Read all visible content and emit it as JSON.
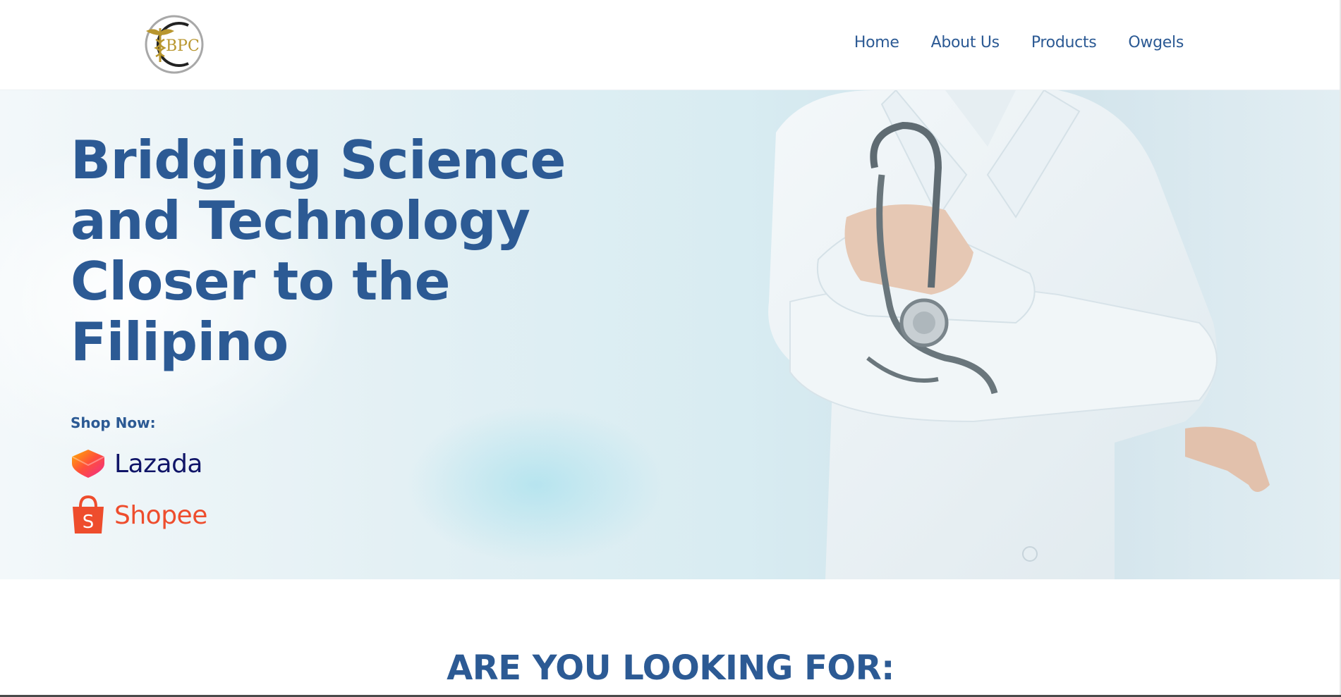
{
  "header": {
    "logo_text": "BPC",
    "nav": [
      {
        "label": "Home"
      },
      {
        "label": "About Us"
      },
      {
        "label": "Products"
      },
      {
        "label": "Owgels"
      }
    ]
  },
  "hero": {
    "headline_lines": [
      "Bridging Science",
      "and Technology",
      "Closer to the",
      "Filipino"
    ],
    "shop_now_label": "Shop Now:",
    "stores": [
      {
        "name": "Lazada",
        "icon": "lazada-heart-icon"
      },
      {
        "name": "Shopee",
        "icon": "shopee-bag-icon"
      }
    ],
    "image": "doctor-with-stethoscope"
  },
  "section": {
    "title": "ARE YOU LOOKING FOR:"
  },
  "colors": {
    "primary": "#2c5a94",
    "lazada": "#101568",
    "shopee": "#ee4d2d",
    "logo_gold": "#b8962e"
  }
}
